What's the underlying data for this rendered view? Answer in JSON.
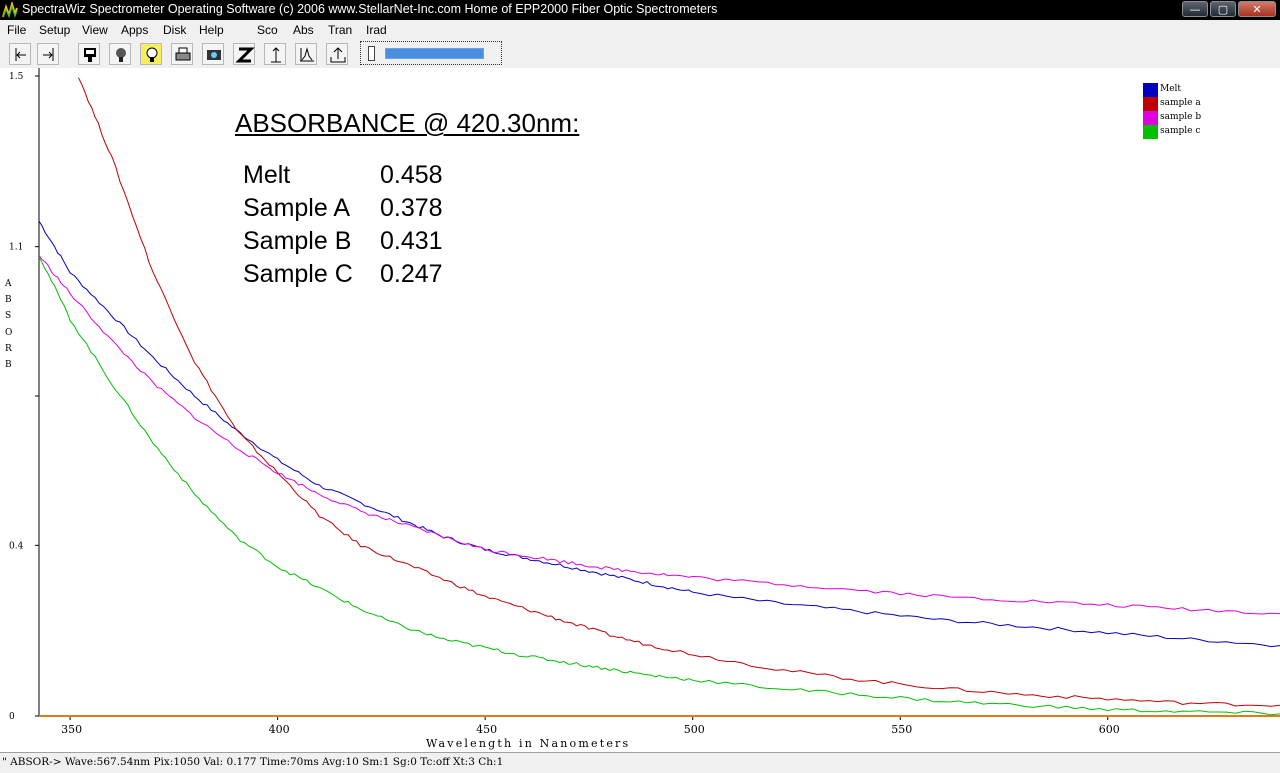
{
  "window": {
    "title": "SpectraWiz  Spectrometer Operating Software (c) 2006  www.StellarNet-Inc.com  Home of EPP2000 Fiber Optic Spectrometers",
    "controls": {
      "minimize": "—",
      "maximize": "▢",
      "close": "✕"
    }
  },
  "menu": {
    "items": [
      "File",
      "Setup",
      "View",
      "Apps",
      "Disk",
      "Help",
      "Sco",
      "Abs",
      "Tran",
      "Irad"
    ]
  },
  "toolbar": {
    "buttons": [
      {
        "icon": "scroll-left-icon"
      },
      {
        "icon": "scroll-right-icon"
      },
      {
        "icon": "save-icon"
      },
      {
        "icon": "bulb-dark-icon"
      },
      {
        "icon": "bulb-light-icon"
      },
      {
        "icon": "print-icon"
      },
      {
        "icon": "camera-icon"
      },
      {
        "icon": "zero-icon"
      },
      {
        "icon": "scale-up-icon"
      },
      {
        "icon": "peak-icon"
      },
      {
        "icon": "export-icon"
      }
    ],
    "integration_slider_level": 0.95
  },
  "annotation": {
    "title": "ABSORBANCE @ 420.30nm:",
    "rows": [
      {
        "label": "Melt",
        "value": "0.458"
      },
      {
        "label": "Sample A",
        "value": "0.378"
      },
      {
        "label": "Sample B",
        "value": "0.431"
      },
      {
        "label": "Sample C",
        "value": "0.247"
      }
    ]
  },
  "chart_data": {
    "type": "line",
    "xlabel": "Wavelength in Nanometers",
    "ylabel": "ABSORB",
    "xlim": [
      342.5,
      641.5
    ],
    "ylim": [
      0,
      1.5
    ],
    "x_ticks": [
      350,
      400,
      450,
      500,
      550,
      600
    ],
    "y_ticks": [
      {
        "value": 0,
        "label": "0"
      },
      {
        "value": 0.4,
        "label": "0.4"
      },
      {
        "value": 0.75,
        "label": ""
      },
      {
        "value": 1.1,
        "label": "1.1"
      },
      {
        "value": 1.5,
        "label": "1.5"
      }
    ],
    "legend_position": "top-right",
    "grid": false,
    "series": [
      {
        "name": "Melt",
        "color": "#0000c0",
        "x": [
          342.5,
          350,
          360,
          370,
          380,
          390,
          400,
          410,
          420,
          430,
          440,
          450,
          460,
          470,
          480,
          490,
          500,
          520,
          540,
          560,
          580,
          600,
          620,
          641.5
        ],
        "y": [
          1.16,
          1.04,
          0.94,
          0.84,
          0.75,
          0.67,
          0.6,
          0.54,
          0.5,
          0.46,
          0.42,
          0.39,
          0.37,
          0.35,
          0.33,
          0.31,
          0.29,
          0.265,
          0.245,
          0.225,
          0.21,
          0.195,
          0.18,
          0.165
        ]
      },
      {
        "name": "sample a",
        "color": "#c00000",
        "x": [
          352,
          360,
          370,
          380,
          390,
          400,
          410,
          420,
          430,
          440,
          450,
          460,
          470,
          480,
          490,
          500,
          520,
          540,
          560,
          580,
          600,
          620,
          641.5
        ],
        "y": [
          1.5,
          1.31,
          1.04,
          0.83,
          0.67,
          0.57,
          0.47,
          0.4,
          0.36,
          0.32,
          0.28,
          0.25,
          0.22,
          0.19,
          0.165,
          0.145,
          0.11,
          0.085,
          0.065,
          0.05,
          0.04,
          0.03,
          0.025
        ]
      },
      {
        "name": "sample b",
        "color": "#e000e0",
        "x": [
          342.5,
          350,
          360,
          370,
          380,
          390,
          400,
          410,
          420,
          430,
          440,
          450,
          460,
          470,
          480,
          490,
          500,
          520,
          540,
          560,
          580,
          600,
          620,
          641.5
        ],
        "y": [
          1.08,
          0.99,
          0.88,
          0.78,
          0.7,
          0.63,
          0.57,
          0.52,
          0.48,
          0.45,
          0.42,
          0.39,
          0.375,
          0.36,
          0.345,
          0.335,
          0.325,
          0.31,
          0.295,
          0.28,
          0.27,
          0.26,
          0.25,
          0.24
        ]
      },
      {
        "name": "sample c",
        "color": "#00c000",
        "x": [
          342.5,
          350,
          360,
          370,
          380,
          390,
          400,
          410,
          420,
          430,
          440,
          450,
          460,
          470,
          480,
          490,
          500,
          520,
          540,
          560,
          580,
          600,
          620,
          641.5
        ],
        "y": [
          1.08,
          0.93,
          0.78,
          0.64,
          0.52,
          0.42,
          0.35,
          0.3,
          0.25,
          0.21,
          0.18,
          0.16,
          0.14,
          0.125,
          0.11,
          0.095,
          0.085,
          0.065,
          0.05,
          0.035,
          0.025,
          0.015,
          0.01,
          0.005
        ]
      }
    ]
  },
  "status": {
    "text": "\" ABSOR->   Wave:567.54nm  Pix:1050  Val:  0.177 Time:70ms  Avg:10  Sm:1  Sg:0  Tc:off  Xt:3  Ch:1"
  }
}
